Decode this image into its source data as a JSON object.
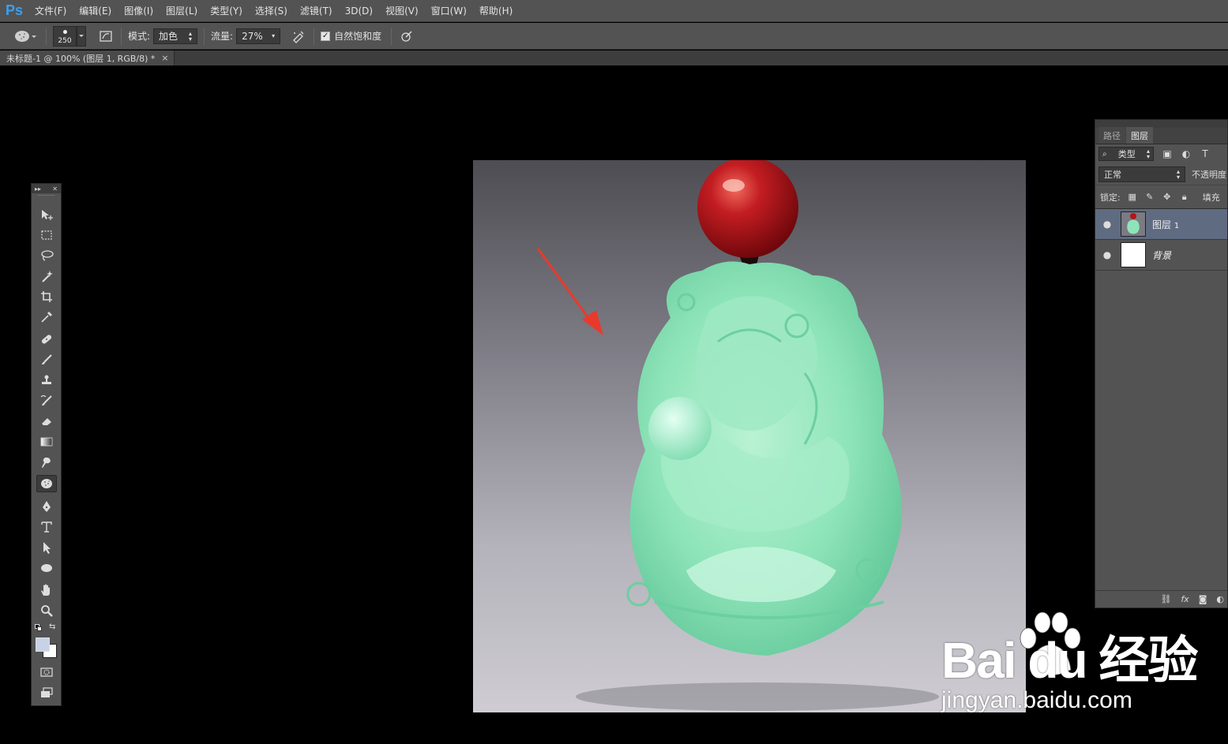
{
  "app": {
    "logo": "Ps"
  },
  "menu": [
    "文件(F)",
    "编辑(E)",
    "图像(I)",
    "图层(L)",
    "类型(Y)",
    "选择(S)",
    "滤镜(T)",
    "3D(D)",
    "视图(V)",
    "窗口(W)",
    "帮助(H)"
  ],
  "options": {
    "brush_size": "250",
    "mode_label": "模式:",
    "mode_value": "加色",
    "flow_label": "流量:",
    "flow_value": "27%",
    "vibrance_label": "自然饱和度",
    "vibrance_checked": true
  },
  "document": {
    "tab_title": "未标题-1 @ 100% (图层 1, RGB/8) *",
    "close_glyph": "×"
  },
  "tools": {
    "active": "sponge-tool",
    "list": [
      "move-tool",
      "marquee-tool",
      "lasso-tool",
      "magic-wand-tool",
      "crop-tool",
      "eyedropper-tool",
      "healing-brush-tool",
      "brush-tool",
      "clone-stamp-tool",
      "history-brush-tool",
      "eraser-tool",
      "gradient-tool",
      "smudge-tool",
      "sponge-tool",
      "pen-tool",
      "type-tool",
      "path-selection-tool",
      "ellipse-tool",
      "hand-tool",
      "zoom-tool"
    ],
    "foreground_color": "#c8d2e6",
    "background_color": "#ffffff"
  },
  "layers_panel": {
    "tabs": [
      "路径",
      "图层"
    ],
    "active_tab": "图层",
    "filter_label": "类型",
    "blend_mode": "正常",
    "opacity_label": "不透明度",
    "lock_label": "锁定:",
    "fill_label": "填充",
    "layers": [
      {
        "name": "图层",
        "suffix": "1",
        "selected": true,
        "visible": true
      },
      {
        "name": "背景",
        "suffix": "",
        "selected": false,
        "visible": true
      }
    ],
    "footer_fx": "fx"
  },
  "watermark": {
    "logo_text": "Bai du 经验",
    "url": "jingyan.baidu.com"
  },
  "colors": {
    "panel": "#535353",
    "jade": "#86e0b4",
    "bead": "#b3141a",
    "arrow": "#e83a2c",
    "ps_blue": "#3aa0f0"
  }
}
